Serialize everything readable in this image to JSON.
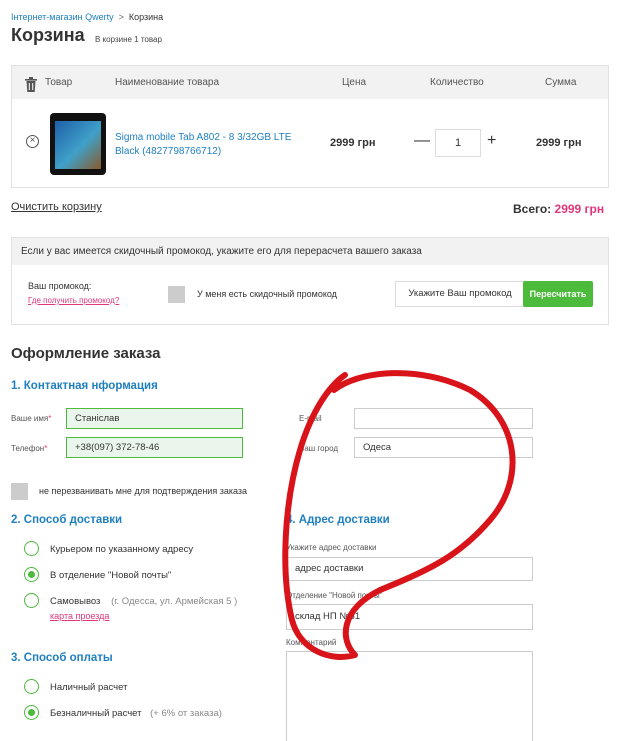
{
  "breadcrumb": {
    "home": "Інтернет-магазин Qwerty",
    "separator": ">",
    "current": "Корзина"
  },
  "page": {
    "title": "Корзина",
    "count": "В корзине 1 товар"
  },
  "cart": {
    "headers": {
      "product": "Товар",
      "name": "Наименование товара",
      "price": "Цена",
      "qty": "Количество",
      "sum": "Сумма"
    },
    "item": {
      "name": "Sigma mobile Tab A802 - 8 3/32GB LTE Black (4827798766712)",
      "price": "2999 грн",
      "qty": "1",
      "minus": "—",
      "plus": "+",
      "sum": "2999 грн",
      "remove": "×"
    },
    "clear": "Очистить корзину",
    "total_label": "Всего:",
    "total_value": "2999 грн"
  },
  "promo": {
    "info": "Если у вас имеется скидочный промокод, укажите его для перерасчета вашего заказа",
    "label": "Ваш промокод:",
    "link": "Где получить промокод?",
    "checkbox_label": "У меня есть скидочный промокод",
    "placeholder": "Укажите Ваш промокод",
    "button": "Пересчитать"
  },
  "order": {
    "title": "Оформление заказа",
    "contact": {
      "title": "1. Контактная нформация",
      "name_label": "Ваше имя",
      "name_value": "Станіслав",
      "phone_label": "Телефон",
      "phone_value": "+38(097) 372-78-46",
      "email_label": "E-mail",
      "city_label": "Ваш город",
      "city_value": "Одеса",
      "required_mark": "*",
      "no_call": "не перезванивать мне для подтверждения заказа"
    },
    "delivery": {
      "title": "2. Способ доставки",
      "options": [
        {
          "label": "Курьером по указанному адресу",
          "note": ""
        },
        {
          "label": "В отделение \"Новой почты\"",
          "note": ""
        },
        {
          "label": "Самовывоз",
          "note": "(г. Одесса, ул. Армейская 5 )"
        }
      ],
      "map_link": "карта проезда"
    },
    "address": {
      "title": "4. Адрес доставки",
      "address_label": "Укажите адрес доставки",
      "address_value": "адрес доставки",
      "branch_label": "Отделение \"Новой почты\"",
      "branch_value": "склад НП №61",
      "comment_label": "Комментарий"
    },
    "payment": {
      "title": "3. Способ оплаты",
      "options": [
        {
          "label": "Наличный расчет",
          "note": ""
        },
        {
          "label": "Безналичный расчет",
          "note": "(+ 6% от заказа)"
        }
      ]
    }
  },
  "colors": {
    "accent": "#1f7fbf",
    "pink": "#e0377b",
    "green": "#4cbb3c",
    "scribble": "#d8141a"
  }
}
